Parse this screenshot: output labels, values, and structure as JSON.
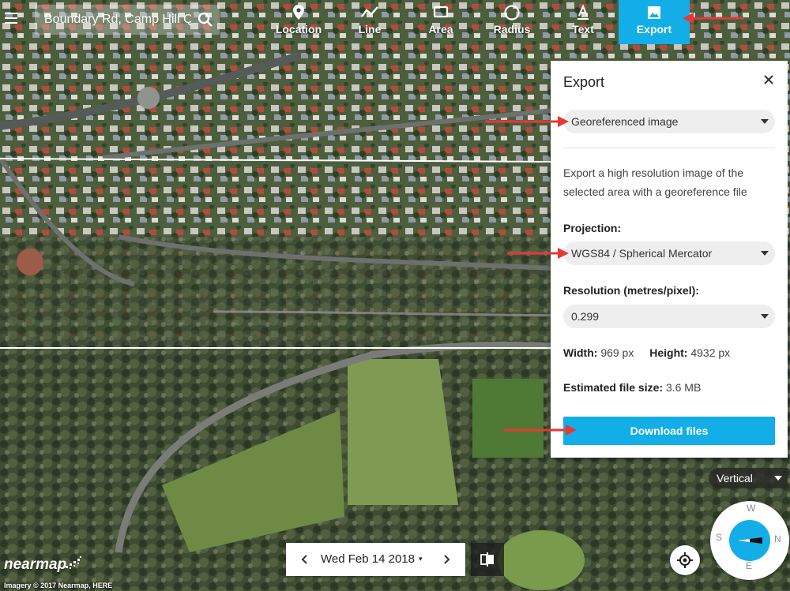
{
  "search": {
    "value": "Boundary Rd, Camp Hill Q"
  },
  "toolbar": {
    "tools": [
      {
        "label": "Location",
        "icon": "location-pin-icon"
      },
      {
        "label": "Line",
        "icon": "line-icon"
      },
      {
        "label": "Area",
        "icon": "area-icon"
      },
      {
        "label": "Radius",
        "icon": "radius-icon"
      },
      {
        "label": "Text",
        "icon": "text-icon"
      },
      {
        "label": "Export",
        "icon": "image-icon",
        "active": true
      }
    ]
  },
  "export_panel": {
    "title": "Export",
    "format_selected": "Georeferenced image",
    "description": "Export a high resolution image of the selected area with a georeference file",
    "projection_label": "Projection:",
    "projection_selected": "WGS84 / Spherical Mercator",
    "resolution_label": "Resolution (metres/pixel):",
    "resolution_selected": "0.299",
    "width_label": "Width:",
    "width_value": "969 px",
    "height_label": "Height:",
    "height_value": "4932 px",
    "filesize_label": "Estimated file size:",
    "filesize_value": "3.6 MB",
    "download_label": "Download files"
  },
  "view_mode": {
    "selected": "Vertical"
  },
  "compass": {
    "north": "N",
    "south": "S",
    "east": "E",
    "west": "W"
  },
  "date_bar": {
    "date": "Wed Feb 14 2018",
    "caret": "▾"
  },
  "brand": {
    "logo": "nearmap",
    "credit": "Imagery © 2017 Nearmap, HERE"
  },
  "colors": {
    "accent": "#13aee8",
    "annotation_arrow": "#e53935"
  }
}
